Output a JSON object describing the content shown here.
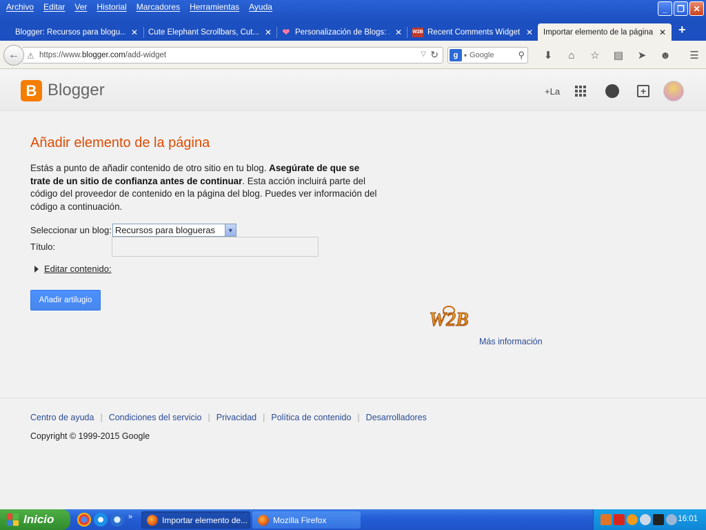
{
  "browser": {
    "menu": [
      "Archivo",
      "Editar",
      "Ver",
      "Historial",
      "Marcadores",
      "Herramientas",
      "Ayuda"
    ],
    "tabs": [
      {
        "label": "Blogger: Recursos para blogu...",
        "icon": ""
      },
      {
        "label": "Cute Elephant Scrollbars, Cut...",
        "icon": ""
      },
      {
        "label": "Personalización de Blogs: ...",
        "icon": "heart-icon"
      },
      {
        "label": "Recent Comments Widget...",
        "icon": "W2B"
      },
      {
        "label": "Importar elemento de la página",
        "icon": ""
      }
    ],
    "url_prefix": "https://www.",
    "url_domain": "blogger.com",
    "url_path": "/add-widget",
    "search_placeholder": "Google",
    "search_engine_letter": "g"
  },
  "header": {
    "brand": "Blogger",
    "brand_letter": "B",
    "plus_user": "+La"
  },
  "main": {
    "title": "Añadir elemento de la página",
    "desc_part1": "Estás a punto de añadir contenido de otro sitio en tu blog. ",
    "desc_bold": "Asegúrate de que se trate de un sitio de confianza antes de continuar",
    "desc_part2": ". Esta acción incluirá parte del código del proveedor de contenido en la página del blog. Puedes ver información del código a continuación.",
    "select_label": "Seleccionar un blog:",
    "select_value": "Recursos para blogueras",
    "title_label": "Título:",
    "title_value": "",
    "edit_content": "Editar contenido:",
    "add_button": "Añadir artilugio",
    "w2b_logo": "W2B",
    "more_info": "Más información"
  },
  "footer": {
    "links": [
      "Centro de ayuda",
      "Condiciones del servicio",
      "Privacidad",
      "Política de contenido",
      "Desarrolladores"
    ],
    "copyright": "Copyright © 1999-2015 Google"
  },
  "taskbar": {
    "start": "Inicio",
    "windows": [
      "Importar elemento de...",
      "Mozilla Firefox"
    ],
    "clock": "16:01"
  },
  "colors": {
    "title_orange": "#dd4b00",
    "link_blue": "#2a4b95",
    "button_blue": "#4d90fe",
    "blogger_orange": "#f57d00"
  }
}
